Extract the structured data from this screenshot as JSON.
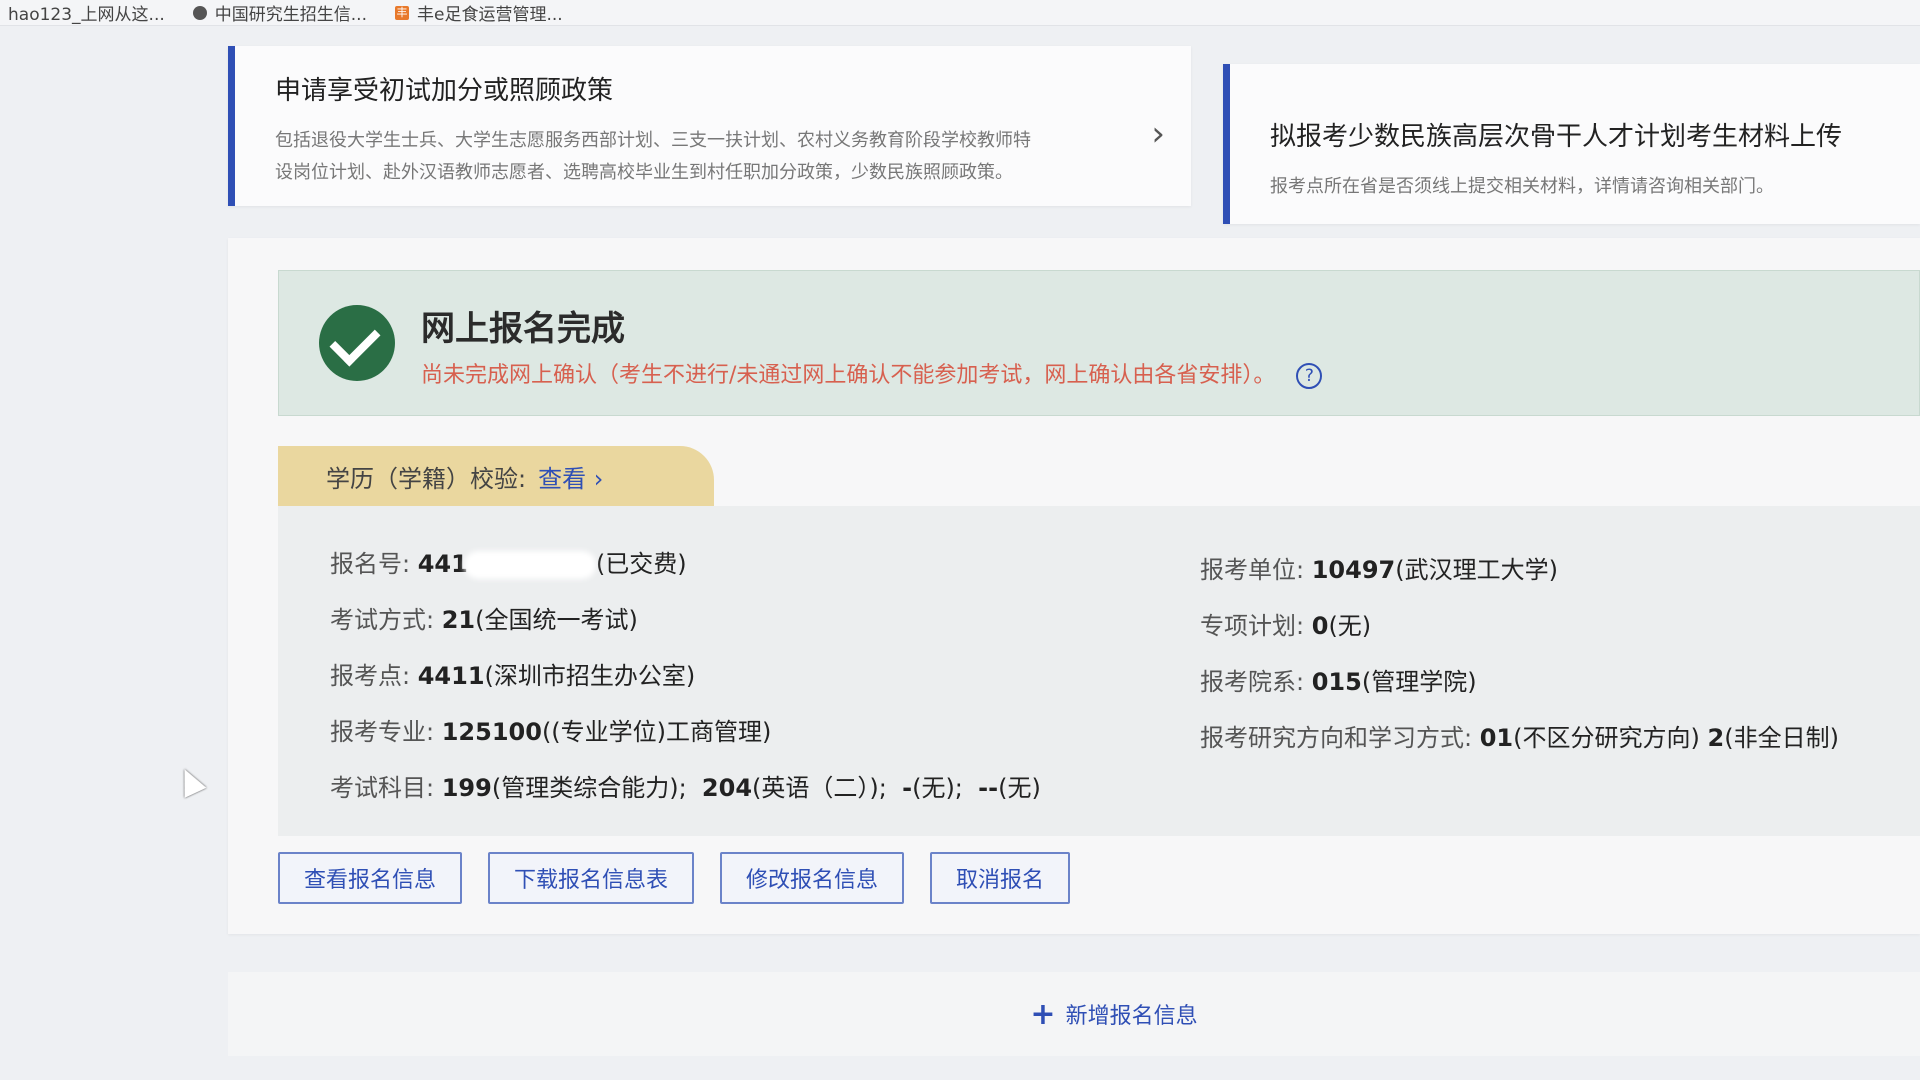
{
  "bookmarks": [
    {
      "label": "hao123_上网从这..."
    },
    {
      "label": "中国研究生招生信..."
    },
    {
      "label": "丰e足食运营管理..."
    }
  ],
  "cards": {
    "left": {
      "title": "申请享受初试加分或照顾政策",
      "desc_line1": "包括退役大学生士兵、大学生志愿服务西部计划、三支一扶计划、农村义务教育阶段学校教师特",
      "desc_line2": "设岗位计划、赴外汉语教师志愿者、选聘高校毕业生到村任职加分政策，少数民族照顾政策。",
      "arrow": "›"
    },
    "right": {
      "title": "拟报考少数民族高层次骨干人才计划考生材料上传",
      "desc": "报考点所在省是否须线上提交相关材料，详情请咨询相关部门。"
    }
  },
  "status": {
    "title": "网上报名完成",
    "subtitle": "尚未完成网上确认（考生不进行/未通过网上确认不能参加考试，网上确认由各省安排）。",
    "help": "?"
  },
  "edu_check": {
    "label": "学历（学籍）校验:",
    "link": "查看 ›"
  },
  "info": {
    "reg_no": {
      "label": "报名号:",
      "prefix": "441",
      "suffix": "(已交费)"
    },
    "exam_mode": {
      "label": "考试方式:",
      "code": "21",
      "text": "(全国统一考试)"
    },
    "exam_site": {
      "label": "报考点:",
      "code": "4411",
      "text": "(深圳市招生办公室)"
    },
    "major": {
      "label": "报考专业:",
      "code": "125100",
      "text": "((专业学位)工商管理)"
    },
    "subjects": {
      "label": "考试科目:",
      "s1code": "199",
      "s1": "(管理类综合能力);",
      "s2code": "204",
      "s2": "(英语（二）);",
      "s3code": "-",
      "s3": "(无);",
      "s4code": "--",
      "s4": "(无)"
    },
    "unit": {
      "label": "报考单位:",
      "code": "10497",
      "text": "(武汉理工大学)"
    },
    "special_plan": {
      "label": "专项计划:",
      "code": "0",
      "text": "(无)"
    },
    "department": {
      "label": "报考院系:",
      "code": "015",
      "text": "(管理学院)"
    },
    "direction": {
      "label": "报考研究方向和学习方式:",
      "code1": "01",
      "text1": "(不区分研究方向)",
      "code2": "2",
      "text2": "(非全日制)"
    }
  },
  "actions": {
    "view": "查看报名信息",
    "download": "下载报名信息表",
    "edit": "修改报名信息",
    "cancel": "取消报名"
  },
  "add": {
    "plus": "+",
    "label": "新增报名信息"
  },
  "colors": {
    "accent": "#2f4fb5",
    "success": "#2a6e45",
    "warning_text": "#d7604f",
    "tab_bg": "#ead79f"
  }
}
